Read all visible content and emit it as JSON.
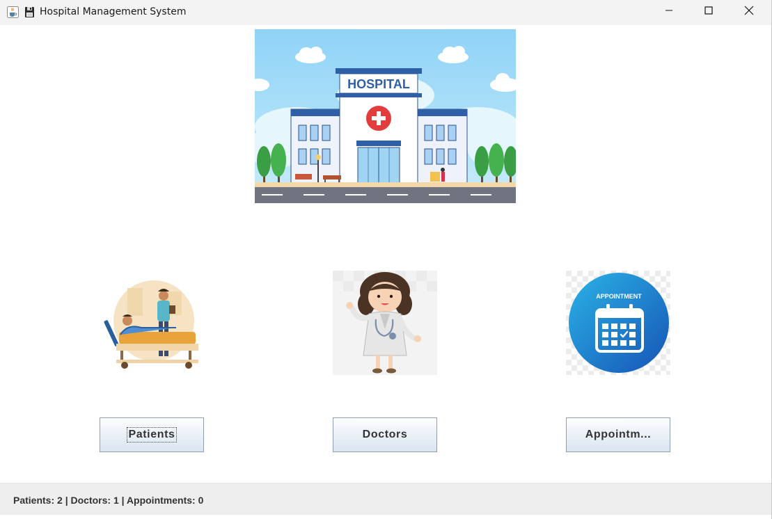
{
  "window": {
    "title": "Hospital Management System",
    "icons": [
      "java-coffee-icon",
      "floppy-disk-icon"
    ],
    "controls": [
      "minimize-icon",
      "maximize-icon",
      "close-icon"
    ]
  },
  "banner": {
    "sign_text": "HOSPITAL"
  },
  "cards": [
    {
      "image": "patient-bed-illustration",
      "button_label": "Patients"
    },
    {
      "image": "doctor-illustration",
      "button_label": "Doctors"
    },
    {
      "image": "appointment-calendar-illustration",
      "button_label": "Appointm...",
      "badge_text": "APPOINTMENT"
    }
  ],
  "status": {
    "text": "Patients: 2 | Doctors: 1 | Appointments: 0"
  },
  "colors": {
    "titlebar_bg": "#f3f3f3",
    "button_border": "#8d9fb6",
    "status_bg": "#eeeeee",
    "appointment_blue": "#1a73c8",
    "hospital_red": "#e23c3c"
  }
}
